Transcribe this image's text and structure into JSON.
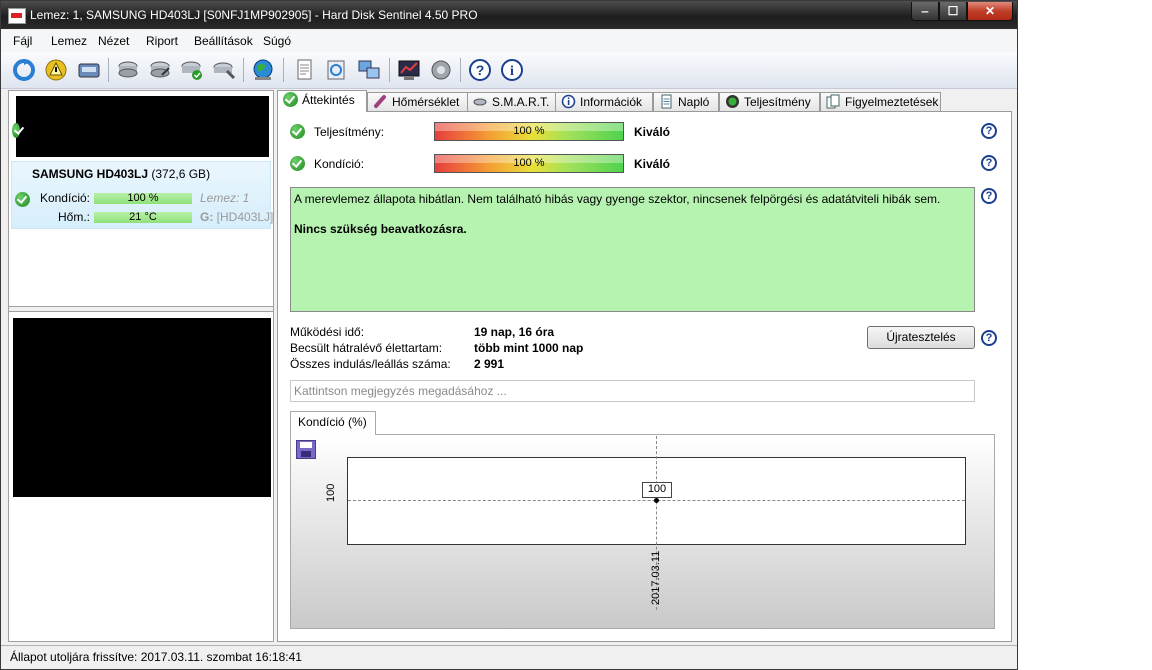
{
  "window": {
    "title": "Lemez: 1, SAMSUNG HD403LJ [S0NFJ1MP902905]  -  Hard Disk Sentinel 4.50 PRO",
    "min": "‒",
    "max": "☐",
    "close": "✕"
  },
  "menu": [
    "Fájl",
    "Lemez",
    "Nézet",
    "Riport",
    "Beállítások",
    "Súgó"
  ],
  "disk": {
    "name": "SAMSUNG HD403LJ",
    "size": " (372,6 GB)",
    "health_label": "Kondíció:",
    "health_value": "100 %",
    "temp_label": "Hőm.:",
    "temp_value": "21 °C",
    "disk_index": "Lemez: 1",
    "drive_letter": "G:",
    "drive_label": " [HD403LJ]"
  },
  "tabs": [
    "Áttekintés",
    "Hőmérséklet",
    "S.M.A.R.T.",
    "Információk",
    "Napló",
    "Teljesítmény",
    "Figyelmeztetések"
  ],
  "overview": {
    "performance_label": "Teljesítmény:",
    "performance_value": "100 %",
    "performance_pct": 100,
    "performance_rating": "Kiváló",
    "health_label": "Kondíció:",
    "health_value": "100 %",
    "health_pct": 100,
    "health_rating": "Kiváló",
    "status_text": "A merevlemez állapota hibátlan. Nem található hibás vagy gyenge szektor, nincsenek felpörgési és adatátviteli hibák sem.",
    "status_action": "Nincs szükség beavatkozásra.",
    "power_on_label": "Működési idő:",
    "power_on_value": "19 nap, 16 óra",
    "lifetime_label": "Becsült hátralévő élettartam:",
    "lifetime_value": "több mint 1000 nap",
    "starts_label": "Összes indulás/leállás száma:",
    "starts_value": "2 991",
    "retest_button": "Újratesztelés",
    "note_placeholder": "Kattintson megjegyzés megadásához ...",
    "help": "?"
  },
  "chart_data": {
    "type": "line",
    "tab_label": "Kondíció  (%)",
    "x": [
      "2017.03.11"
    ],
    "series": [
      {
        "values": [
          100
        ]
      }
    ],
    "y_ticks": [
      "100"
    ],
    "point_labels": [
      "100"
    ]
  },
  "statusbar": {
    "text": "Állapot utoljára frissítve: 2017.03.11. szombat 16:18:41"
  }
}
